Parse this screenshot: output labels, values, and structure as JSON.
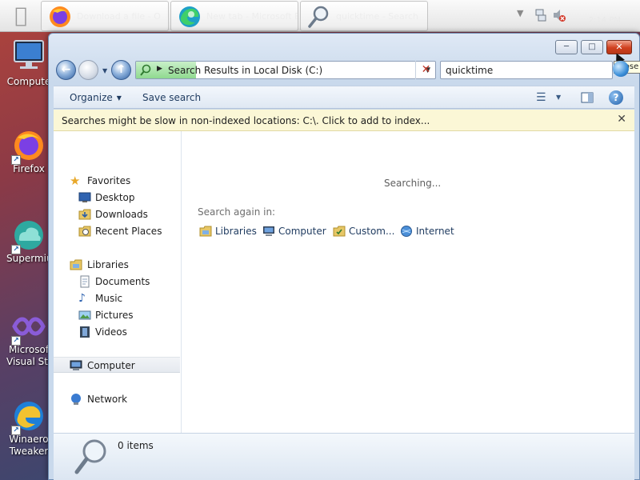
{
  "taskbar": {
    "apple_icon": "apple-logo-icon",
    "buttons": [
      {
        "label": "Download a file - O",
        "icon": "firefox-icon"
      },
      {
        "label": "New tab - Microsoft Edge",
        "icon": "edge-icon"
      },
      {
        "label": "quicktime - Search",
        "icon": "search-magnifier-icon"
      }
    ],
    "tray": {
      "clock": "2:14 PM"
    }
  },
  "desktop": {
    "icons": [
      {
        "label": "Compute",
        "icon": "monitor-icon"
      },
      {
        "label": "Firefox",
        "icon": "firefox-icon"
      },
      {
        "label": "Supermiu",
        "icon": "cloud-icon"
      },
      {
        "label": "Microsof Visual Stud",
        "line1": "Microsof",
        "line2": "Visual Stud",
        "icon": "visual-studio-icon"
      },
      {
        "label": "Winaero Tweaker",
        "line1": "Winaero",
        "line2": "Tweaker",
        "icon": "winaero-icon"
      }
    ]
  },
  "window": {
    "controls": {
      "minimize": "─",
      "maximize": "□",
      "close": "✕"
    },
    "tooltip": "Close",
    "address": {
      "text": "Search Results in Local Disk (C:)",
      "progress_fraction": 0.2
    },
    "search": {
      "value": "quicktime"
    },
    "commandbar": {
      "organize": "Organize",
      "save_search": "Save search"
    },
    "infobar": {
      "text": "Searches might be slow in non-indexed locations: C:\\. Click to add to index..."
    },
    "navpane": {
      "favorites_header": "Favorites",
      "favorites": [
        {
          "label": "Desktop",
          "icon": "desktop-folder-icon"
        },
        {
          "label": "Downloads",
          "icon": "downloads-folder-icon"
        },
        {
          "label": "Recent Places",
          "icon": "recent-places-icon"
        }
      ],
      "libraries_header": "Libraries",
      "libraries": [
        {
          "label": "Documents",
          "icon": "documents-icon"
        },
        {
          "label": "Music",
          "icon": "music-icon"
        },
        {
          "label": "Pictures",
          "icon": "pictures-icon"
        },
        {
          "label": "Videos",
          "icon": "videos-icon"
        }
      ],
      "computer": "Computer",
      "network": "Network"
    },
    "content": {
      "status": "Searching...",
      "search_again_label": "Search again in:",
      "search_again": [
        {
          "label": "Libraries",
          "icon": "libraries-icon"
        },
        {
          "label": "Computer",
          "icon": "computer-icon"
        },
        {
          "label": "Custom...",
          "icon": "custom-folder-icon"
        },
        {
          "label": "Internet",
          "icon": "internet-globe-icon"
        }
      ]
    },
    "details": {
      "items_count": "0 items"
    }
  },
  "colors": {
    "accent": "#1f5ea8",
    "close_red": "#d0401f",
    "infobar_bg": "#fbf7d6",
    "progress_green": "#8fd98f"
  }
}
